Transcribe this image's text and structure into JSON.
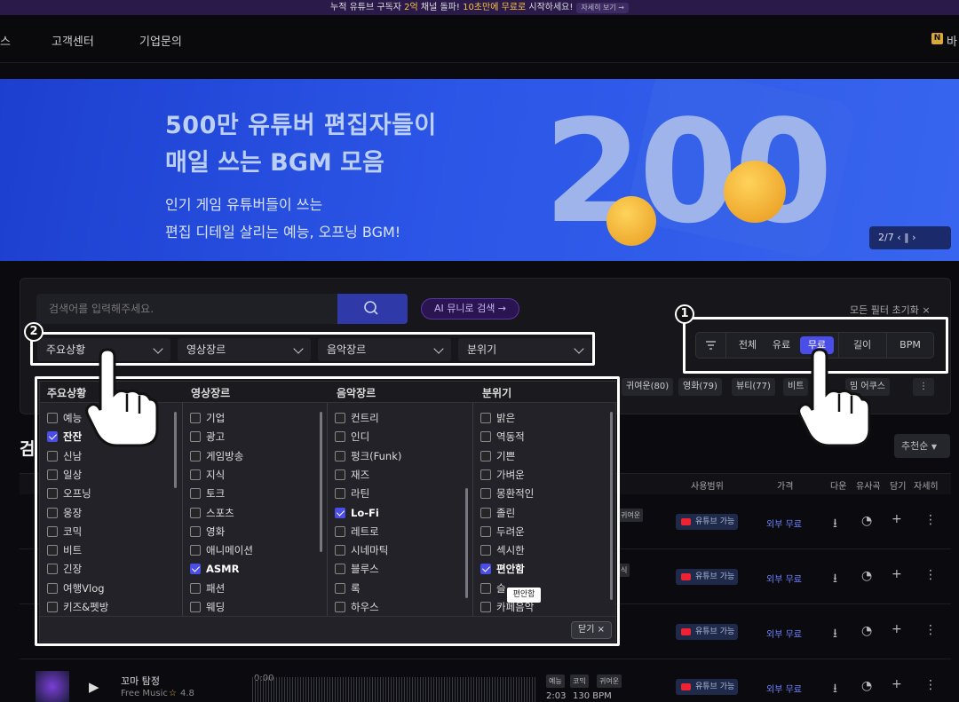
{
  "top_banner": {
    "pre": "누적 유튜브 구독자 ",
    "highlight": "2억",
    "mid": " 채널 돌파! ",
    "highlight2": "10초만에 무료로",
    "post": " 시작하세요!",
    "cta": "자세히 보기 →"
  },
  "nav": {
    "item_partial": "스",
    "support": "고객센터",
    "business": "기업문의",
    "right_badge": "N",
    "right_partial": "바"
  },
  "hero": {
    "line1": "500만 유튜버 편집자들이",
    "line2": "매일 쓰는 BGM 모음",
    "line3": "인기 게임 유튜버들이 쓰는",
    "line4": "편집 디테일 살리는 예능, 오프닝 BGM!",
    "big_number": "200",
    "pager": "2/7  ‹  ‖  ›"
  },
  "search": {
    "placeholder": "검색어를 입력해주세요.",
    "ai_button": "AI 뮤니로 검색 →",
    "reset": "모든 필터 초기화 ×"
  },
  "price_filter": {
    "options": [
      "전체",
      "유료",
      "무료",
      "길이",
      "BPM"
    ],
    "active": "무료"
  },
  "dropdowns": [
    "주요상황",
    "영상장르",
    "음악장르",
    "분위기"
  ],
  "tags": [
    "귀여운(80)",
    "영화(79)",
    "뷰티(77)",
    "비트",
    "밈 어쿠스"
  ],
  "sort": "추천순",
  "section_title": "검",
  "table_head": {
    "usage": "사용범위",
    "price": "가격",
    "down": "다운",
    "similar": "유사곡",
    "save": "담기",
    "detail": "자세히"
  },
  "rows": [
    {
      "usage": "유튜브 가능",
      "price": "외부 무료",
      "tag": "귀여운"
    },
    {
      "usage": "유튜브 가능",
      "price": "외부 무료",
      "tag": "식"
    },
    {
      "usage": "유튜브 가능",
      "price": "외부 무료",
      "tag": ""
    },
    {
      "usage": "유튜브 가능",
      "price": "외부 무료",
      "title": "꼬마 탐정",
      "source": "Free Music",
      "rating": "4.8",
      "time_now": "0:00",
      "duration": "2:03",
      "bpm": "130 BPM",
      "tags": [
        "예능",
        "코믹",
        "귀여운"
      ]
    }
  ],
  "menu": {
    "headers": [
      "주요상황",
      "영상장르",
      "음악장르",
      "분위기"
    ],
    "col1": [
      {
        "label": "예능",
        "on": false
      },
      {
        "label": "잔잔",
        "on": true
      },
      {
        "label": "신남",
        "on": false
      },
      {
        "label": "일상",
        "on": false
      },
      {
        "label": "오프닝",
        "on": false
      },
      {
        "label": "웅장",
        "on": false
      },
      {
        "label": "코믹",
        "on": false
      },
      {
        "label": "비트",
        "on": false
      },
      {
        "label": "긴장",
        "on": false
      },
      {
        "label": "여행Vlog",
        "on": false
      },
      {
        "label": "키즈&펫방",
        "on": false
      }
    ],
    "col2": [
      {
        "label": "기업",
        "on": false
      },
      {
        "label": "광고",
        "on": false
      },
      {
        "label": "게임방송",
        "on": false
      },
      {
        "label": "지식",
        "on": false
      },
      {
        "label": "토크",
        "on": false
      },
      {
        "label": "스포츠",
        "on": false
      },
      {
        "label": "영화",
        "on": false
      },
      {
        "label": "애니메이션",
        "on": false
      },
      {
        "label": "ASMR",
        "on": true
      },
      {
        "label": "패션",
        "on": false
      },
      {
        "label": "웨딩",
        "on": false
      }
    ],
    "col3": [
      {
        "label": "컨트리",
        "on": false
      },
      {
        "label": "인디",
        "on": false
      },
      {
        "label": "펑크(Funk)",
        "on": false
      },
      {
        "label": "재즈",
        "on": false
      },
      {
        "label": "라틴",
        "on": false
      },
      {
        "label": "Lo-Fi",
        "on": true
      },
      {
        "label": "레트로",
        "on": false
      },
      {
        "label": "시네마틱",
        "on": false
      },
      {
        "label": "블루스",
        "on": false
      },
      {
        "label": "록",
        "on": false
      },
      {
        "label": "하우스",
        "on": false
      }
    ],
    "col4": [
      {
        "label": "밝은",
        "on": false
      },
      {
        "label": "역동적",
        "on": false
      },
      {
        "label": "기쁜",
        "on": false
      },
      {
        "label": "가벼운",
        "on": false
      },
      {
        "label": "몽환적인",
        "on": false
      },
      {
        "label": "졸린",
        "on": false
      },
      {
        "label": "두려운",
        "on": false
      },
      {
        "label": "섹시한",
        "on": false
      },
      {
        "label": "편안함",
        "on": true
      },
      {
        "label": "슬",
        "on": false
      },
      {
        "label": "카페음악",
        "on": false
      }
    ],
    "close": "닫기 ×",
    "tooltip": "편안함"
  },
  "annotations": {
    "badge1": "1",
    "badge2": "2"
  },
  "colors": {
    "accent": "#4a4de8",
    "highlight_box": "#ffffff",
    "price": "#6d82ff"
  }
}
